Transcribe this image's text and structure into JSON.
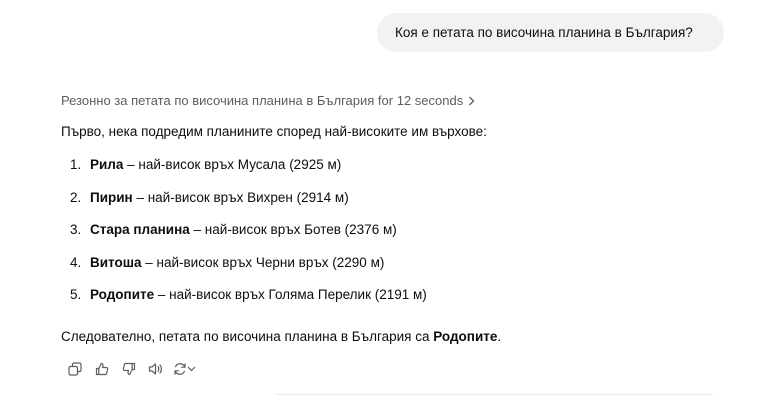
{
  "user_message": "Коя е петата по височина планина в България?",
  "reasoning_label": "Резонно за петата по височина планина в България for 12 seconds",
  "intro": "Първо, нека подредим планините според най-високите им върхове:",
  "mountains": [
    {
      "num": "1.",
      "name": "Рила",
      "rest": " – най-висок връх Мусала (2925 м)"
    },
    {
      "num": "2.",
      "name": "Пирин",
      "rest": " – най-висок връх Вихрен (2914 м)"
    },
    {
      "num": "3.",
      "name": "Стара планина",
      "rest": " – най-висок връх Ботев (2376 м)"
    },
    {
      "num": "4.",
      "name": "Витоша",
      "rest": " – най-висок връх Черни връх (2290 м)"
    },
    {
      "num": "5.",
      "name": "Родопите",
      "rest": " – най-висок връх Голяма Перелик (2191 м)"
    }
  ],
  "conclusion": {
    "prefix": "Следователно, петата по височина планина в България са ",
    "bold": "Родопите",
    "suffix": "."
  },
  "action_icons": [
    "copy-icon",
    "thumbs-up-icon",
    "thumbs-down-icon",
    "read-aloud-icon",
    "regenerate-icon"
  ]
}
